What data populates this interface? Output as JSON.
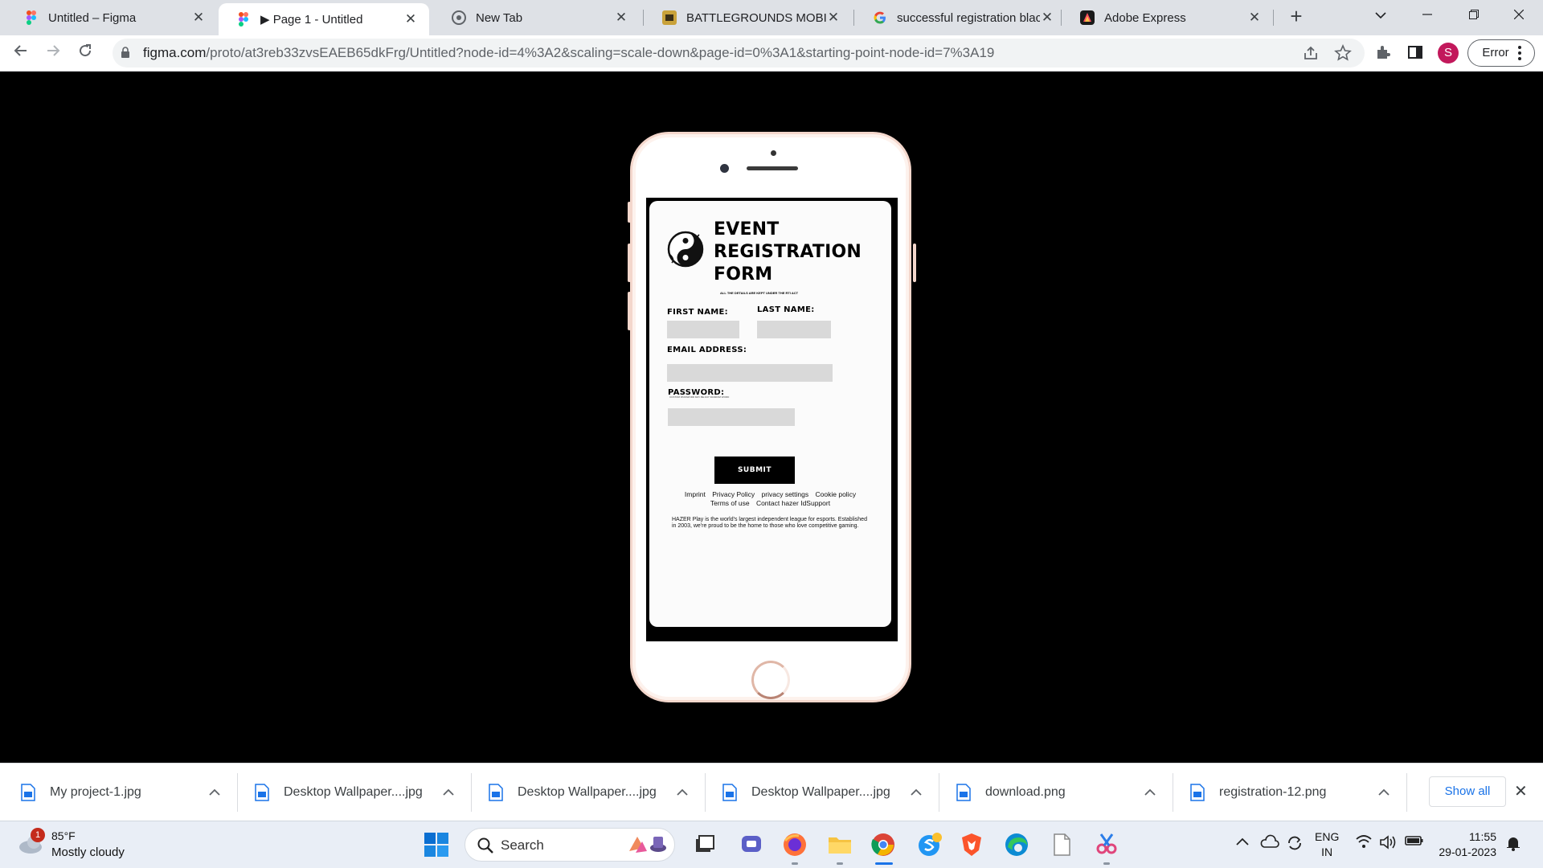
{
  "browser": {
    "tabs": [
      {
        "title": "Untitled – Figma",
        "icon": "figma-icon"
      },
      {
        "title": "▶ Page 1 - Untitled",
        "icon": "figma-icon",
        "active": true
      },
      {
        "title": "New Tab",
        "icon": "chrome-icon"
      },
      {
        "title": "BATTLEGROUNDS MOBILE I",
        "icon": "bgmi-icon"
      },
      {
        "title": "successful registration blacl",
        "icon": "google-icon"
      },
      {
        "title": "Adobe Express",
        "icon": "adobe-express-icon"
      }
    ],
    "new_tab_label": "+",
    "url_host": "figma.com",
    "url_path": "/proto/at3reb33zvsEAEB65dkFrg/Untitled?node-id=4%3A2&scaling=scale-down&page-id=0%3A1&starting-point-node-id=7%3A19",
    "profile_initial": "S",
    "error_label": "Error"
  },
  "form": {
    "title_lines": [
      "EVENT",
      "REGISTRATION",
      "FORM"
    ],
    "subtitle": "ALL THE DETAILS ARE KEPT UNDER THE RTI ACT",
    "first_name_label": "FIRST NAME:",
    "last_name_label": "LAST NAME:",
    "email_label": "EMAIL ADDRESS:",
    "password_label": "PASSWORD:",
    "password_note": "CUSTOM PASSWORD MAY BE ANY RANDOM WORD",
    "submit_label": "SUBMIT",
    "footer_links_row1": [
      "Imprint",
      "Privacy Policy",
      "privacy settings",
      "Cookie policy"
    ],
    "footer_links_row2": [
      "Terms of use",
      "Contact hazer IdSupport"
    ],
    "about_text": "HAZER Play is the world's largest independent league for esports. Established in 2003, we're proud to be the home to those who love competitive gaming."
  },
  "downloads": {
    "items": [
      "My project-1.jpg",
      "Desktop Wallpaper....jpg",
      "Desktop Wallpaper....jpg",
      "Desktop Wallpaper....jpg",
      "download.png",
      "registration-12.png"
    ],
    "show_all": "Show all"
  },
  "taskbar": {
    "weather_badge": "1",
    "temperature": "85°F",
    "weather_desc": "Mostly cloudy",
    "search_label": "Search",
    "lang_top": "ENG",
    "lang_bottom": "IN",
    "time": "11:55",
    "date": "29-01-2023"
  },
  "colors": {
    "tabstrip": "#dee1e6",
    "phone_frame": "#f4d7cc",
    "submit_bg": "#000000",
    "input_bg": "#d9d9d9",
    "accent_link": "#1a73e8"
  }
}
